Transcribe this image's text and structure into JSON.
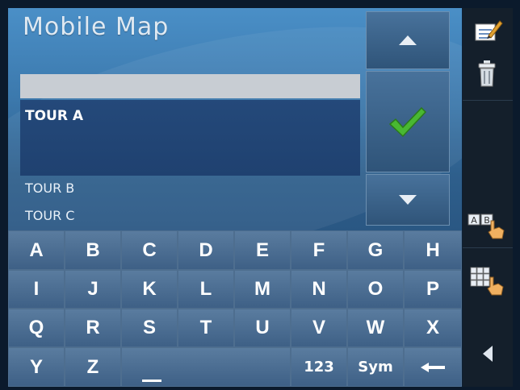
{
  "app": {
    "title": "Mobile Map"
  },
  "search": {
    "value": ""
  },
  "list": {
    "selected": "TOUR A",
    "items": [
      "TOUR B",
      "TOUR C"
    ]
  },
  "keyboard": {
    "rows": [
      [
        "A",
        "B",
        "C",
        "D",
        "E",
        "F",
        "G",
        "H"
      ],
      [
        "I",
        "J",
        "K",
        "L",
        "M",
        "N",
        "O",
        "P"
      ],
      [
        "Q",
        "R",
        "S",
        "T",
        "U",
        "V",
        "W",
        "X"
      ]
    ],
    "last_row": {
      "y": "Y",
      "z": "Z",
      "numbers": "123",
      "symbols": "Sym"
    }
  },
  "icons": {
    "scroll_up": "triangle-up-icon",
    "confirm": "checkmark-icon",
    "scroll_down": "triangle-down-icon",
    "edit": "notepad-pencil-icon",
    "delete": "trash-can-icon",
    "abc_keyboard": "ab-keys-hand-icon",
    "grid_keyboard": "grid-keys-hand-icon",
    "back": "triangle-left-icon",
    "space": "space-bar-icon",
    "backspace": "left-arrow-icon"
  },
  "colors": {
    "accent_green": "#49b832",
    "selection": "#24497a"
  }
}
